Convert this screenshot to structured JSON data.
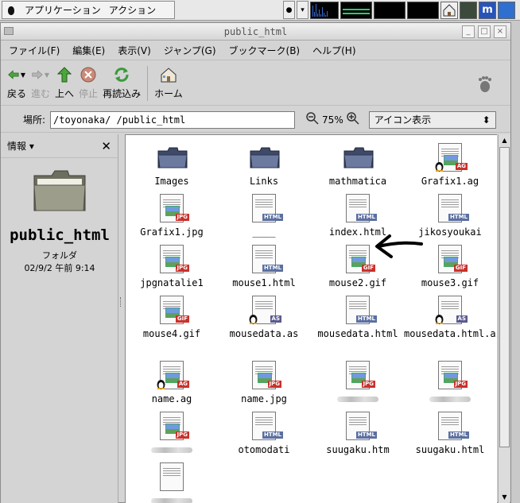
{
  "panel": {
    "menu_apps": "アプリケーション",
    "menu_actions": "アクション"
  },
  "window": {
    "title": "public_html"
  },
  "menubar": [
    "ファイル(F)",
    "編集(E)",
    "表示(V)",
    "ジャンプ(G)",
    "ブックマーク(B)",
    "ヘルプ(H)"
  ],
  "toolbar": {
    "back": "戻る",
    "forward": "進む",
    "up": "上へ",
    "stop": "停止",
    "reload": "再読込み",
    "home": "ホーム"
  },
  "location": {
    "label": "場所:",
    "path": "/toyonaka/              /public_html",
    "zoom": "75%",
    "view_mode": "アイコン表示"
  },
  "side": {
    "header": "情報",
    "folder_name": "public_html",
    "folder_type": "フォルダ",
    "modified": "02/9/2 午前 9:14"
  },
  "files": [
    {
      "name": "Images",
      "kind": "folder"
    },
    {
      "name": "Links",
      "kind": "folder"
    },
    {
      "name": "mathmatica",
      "kind": "folder"
    },
    {
      "name": "Grafix1.ag",
      "kind": "ag"
    },
    {
      "name": "Grafix1.jpg",
      "kind": "jpg"
    },
    {
      "name": "____",
      "kind": "html"
    },
    {
      "name": "index.html",
      "kind": "html"
    },
    {
      "name": "jikosyoukai",
      "kind": "html"
    },
    {
      "name": "jpgnatalie1",
      "kind": "jpg"
    },
    {
      "name": "mouse1.html",
      "kind": "html"
    },
    {
      "name": "mouse2.gif",
      "kind": "gif"
    },
    {
      "name": "mouse3.gif",
      "kind": "gif"
    },
    {
      "name": "mouse4.gif",
      "kind": "gif"
    },
    {
      "name": "mousedata.as",
      "kind": "as"
    },
    {
      "name": "mousedata.html",
      "kind": "html"
    },
    {
      "name": "mousedata.html.as",
      "kind": "as"
    },
    {
      "name": "name.ag",
      "kind": "ag"
    },
    {
      "name": "name.jpg",
      "kind": "jpg"
    },
    {
      "name": "",
      "kind": "jpg"
    },
    {
      "name": "",
      "kind": "jpg"
    },
    {
      "name": "",
      "kind": "jpg"
    },
    {
      "name": "otomodati",
      "kind": "html"
    },
    {
      "name": "suugaku.htm",
      "kind": "html"
    },
    {
      "name": "suugaku.html",
      "kind": "html"
    },
    {
      "name": "",
      "kind": "doc"
    }
  ],
  "colors": {
    "window_bg": "#d4d4d4",
    "icon_view_bg": "#ffffff",
    "badge_red": "#c8312b",
    "badge_html": "#5b6fa0"
  }
}
